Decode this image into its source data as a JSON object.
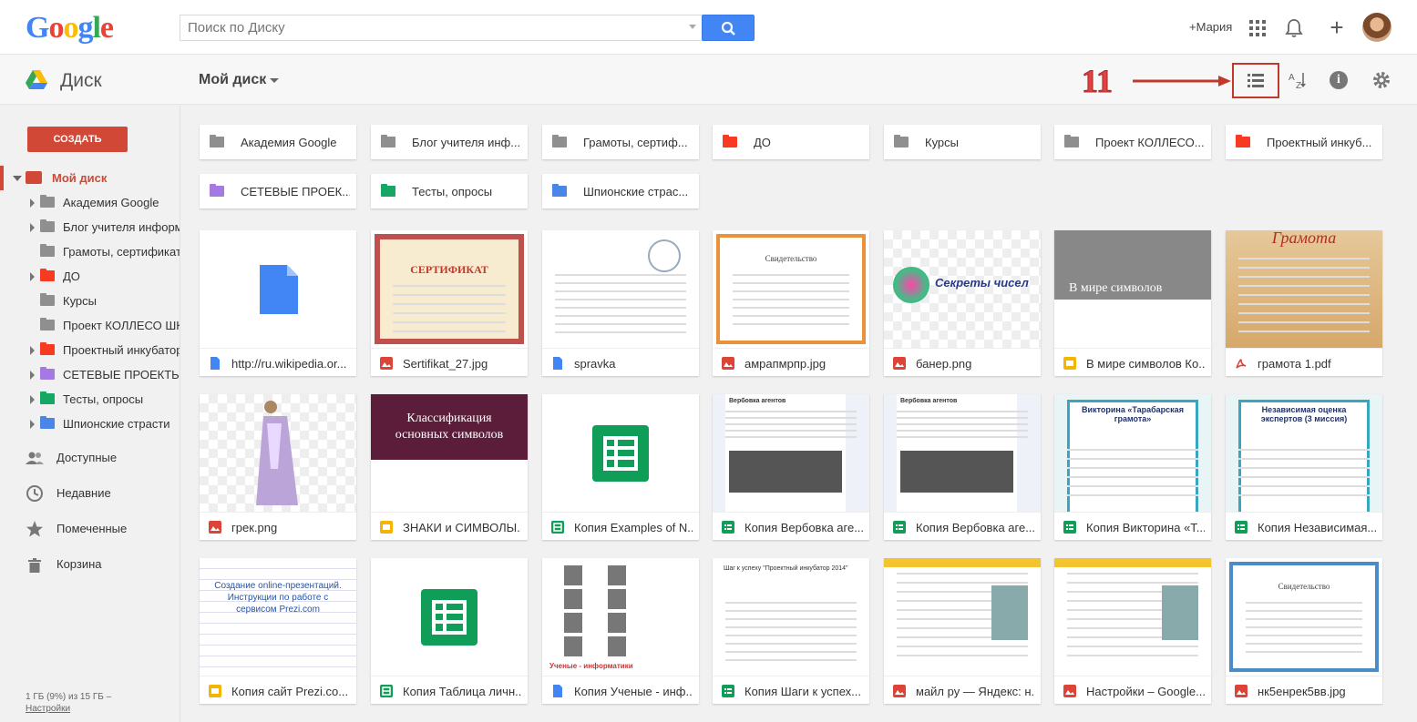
{
  "header": {
    "logo": "Google",
    "search_placeholder": "Поиск по Диску",
    "user": "+Мария"
  },
  "subbar": {
    "app_name": "Диск",
    "breadcrumb": "Мой диск",
    "annotation_number": "11"
  },
  "sidebar": {
    "create_label": "СОЗДАТЬ",
    "root_label": "Мой диск",
    "folders": [
      {
        "label": "Академия Google",
        "color": "#8f8f8f",
        "expandable": true
      },
      {
        "label": "Блог учителя информатики",
        "color": "#8f8f8f",
        "expandable": true
      },
      {
        "label": "Грамоты, сертификаты",
        "color": "#8f8f8f",
        "expandable": false
      },
      {
        "label": "ДО",
        "color": "#f83a22",
        "expandable": true
      },
      {
        "label": "Курсы",
        "color": "#8f8f8f",
        "expandable": false
      },
      {
        "label": "Проект КОЛЛЕСО ШКОЛЫ",
        "color": "#8f8f8f",
        "expandable": false
      },
      {
        "label": "Проектный инкубатор",
        "color": "#f83a22",
        "expandable": true
      },
      {
        "label": "СЕТЕВЫЕ ПРОЕКТЫ",
        "color": "#a47ae2",
        "expandable": true
      },
      {
        "label": "Тесты, опросы",
        "color": "#16a765",
        "expandable": true
      },
      {
        "label": "Шпионские страсти",
        "color": "#4986e7",
        "expandable": true
      }
    ],
    "nav": [
      {
        "label": "Доступные",
        "icon": "people-icon"
      },
      {
        "label": "Недавние",
        "icon": "clock-icon"
      },
      {
        "label": "Помеченные",
        "icon": "star-icon"
      },
      {
        "label": "Корзина",
        "icon": "trash-icon"
      }
    ],
    "storage": "1 ГБ (9%) из 15 ГБ –",
    "settings_link": "Настройки"
  },
  "folders": [
    {
      "label": "Академия Google",
      "color": "#8f8f8f"
    },
    {
      "label": "Блог учителя инф...",
      "color": "#8f8f8f"
    },
    {
      "label": "Грамоты, сертиф...",
      "color": "#8f8f8f"
    },
    {
      "label": "ДО",
      "color": "#f83a22"
    },
    {
      "label": "Курсы",
      "color": "#8f8f8f"
    },
    {
      "label": "Проект КОЛЛЕСО...",
      "color": "#8f8f8f"
    },
    {
      "label": "Проектный инкуб...",
      "color": "#f83a22"
    },
    {
      "label": "СЕТЕВЫЕ ПРОЕК...",
      "color": "#a47ae2"
    },
    {
      "label": "Тесты, опросы",
      "color": "#16a765"
    },
    {
      "label": "Шпионские страс...",
      "color": "#4986e7"
    }
  ],
  "files": [
    {
      "name": "http://ru.wikipedia.or...",
      "type": "doc",
      "thumb": "doc-icon"
    },
    {
      "name": "Sertifikat_27.jpg",
      "type": "image",
      "thumb": "certificate",
      "text": "СЕРТИФИКАТ"
    },
    {
      "name": "spravka",
      "type": "doc",
      "thumb": "page"
    },
    {
      "name": "амрапмрпр.jpg",
      "type": "image",
      "thumb": "svid",
      "text": "Свидетельство"
    },
    {
      "name": "банер.png",
      "type": "image",
      "thumb": "banner",
      "text": "Секреты чисел"
    },
    {
      "name": "В мире символов Ко...",
      "type": "slides",
      "thumb": "gray-title",
      "text": "В мире символов"
    },
    {
      "name": "грамота 1.pdf",
      "type": "pdf",
      "thumb": "gramota",
      "text": "Грамота"
    },
    {
      "name": "грек.png",
      "type": "image",
      "thumb": "figure"
    },
    {
      "name": "ЗНАКИ и СИМВОЛЫ...",
      "type": "slides",
      "thumb": "dark-title",
      "text": "Классификация основных символов"
    },
    {
      "name": "Копия Examples of N...",
      "type": "sheet",
      "thumb": "sheet-icon"
    },
    {
      "name": "Копия Вербовка аге...",
      "type": "form",
      "thumb": "form-page",
      "text": "Вербовка агентов"
    },
    {
      "name": "Копия Вербовка аге...",
      "type": "form",
      "thumb": "form-page",
      "text": "Вербовка агентов"
    },
    {
      "name": "Копия Викторина «Т...",
      "type": "form",
      "thumb": "quiz",
      "text": "Викторина «Тарабарская грамота»"
    },
    {
      "name": "Копия Независимая...",
      "type": "form",
      "thumb": "quiz",
      "text": "Независимая оценка экспертов (3 миссия)"
    },
    {
      "name": "Копия сайт Prezi.co...",
      "type": "slides",
      "thumb": "prezi",
      "text": "Создание online-презентаций. Инструкции по работе с сервисом Prezi.com"
    },
    {
      "name": "Копия Таблица личн...",
      "type": "sheet",
      "thumb": "sheet-icon"
    },
    {
      "name": "Копия Ученые - инф...",
      "type": "doc",
      "thumb": "portraits",
      "text": "Ученые - информатики"
    },
    {
      "name": "Копия Шаги к успех...",
      "type": "form",
      "thumb": "page",
      "text": "Шаг к успеху \"Проектный инкубатор 2014\""
    },
    {
      "name": "майл ру — Яндекс: н...",
      "type": "image",
      "thumb": "screenshot"
    },
    {
      "name": "Настройки – Google...",
      "type": "image",
      "thumb": "screenshot"
    },
    {
      "name": "нк5енрек5вв.jpg",
      "type": "image",
      "thumb": "svid2",
      "text": "Свидетельство"
    }
  ],
  "colors": {
    "doc": "#4285f4",
    "image": "#db4437",
    "slides": "#f4b400",
    "sheet": "#0f9d58",
    "form": "#0f9d58",
    "pdf": "#db4437",
    "accent": "#d14836"
  }
}
